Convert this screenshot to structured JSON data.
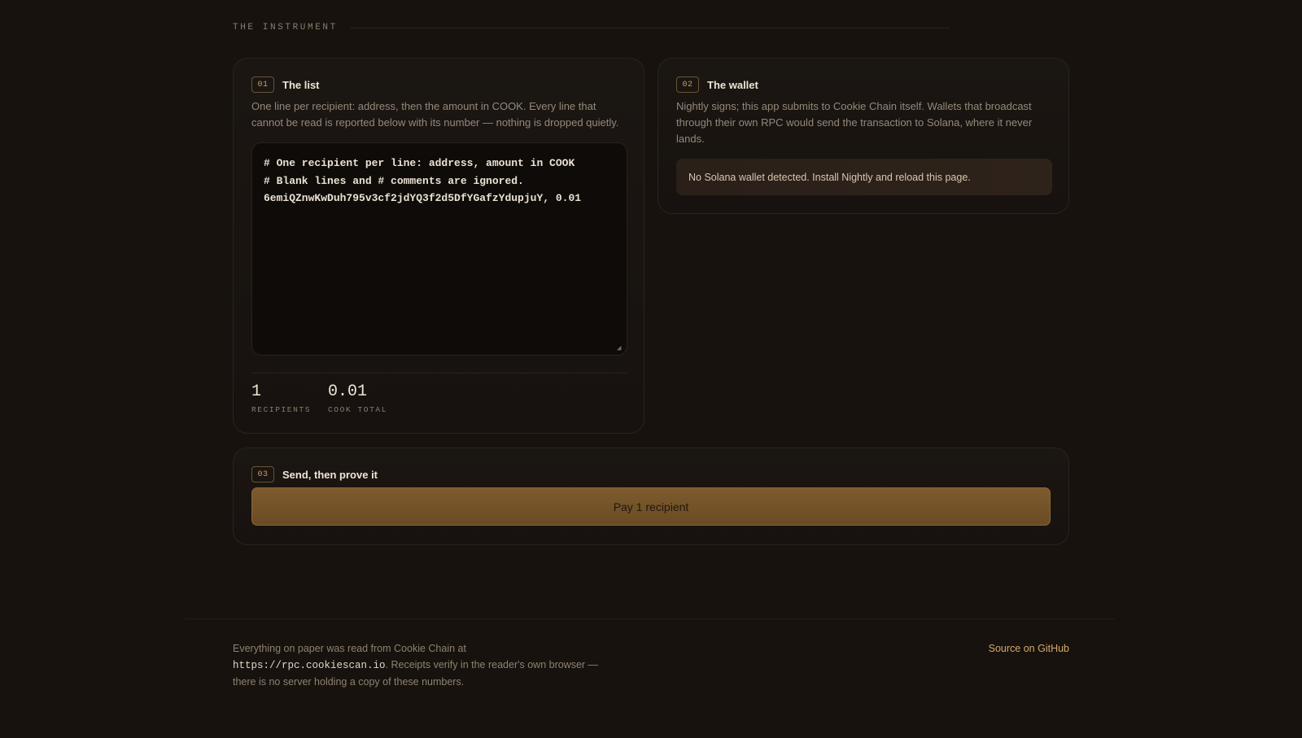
{
  "section": {
    "label": "THE INSTRUMENT"
  },
  "list_card": {
    "step": "01",
    "title": "The list",
    "description": "One line per recipient: address, then the amount in COOK. Every line that cannot be read is reported below with its number — nothing is dropped quietly.",
    "textarea_value": "# One recipient per line: address, amount in COOK\n# Blank lines and # comments are ignored.\n6emiQZnwKwDuh795v3cf2jdYQ3f2d5DfYGafzYdupjuY, 0.01",
    "stats": {
      "recipients_value": "1",
      "recipients_label": "RECIPIENTS",
      "total_value": "0.01",
      "total_label": "COOK TOTAL"
    }
  },
  "wallet_card": {
    "step": "02",
    "title": "The wallet",
    "description": "Nightly signs; this app submits to Cookie Chain itself. Wallets that broadcast through their own RPC would send the transaction to Solana, where it never lands.",
    "notice": "No Solana wallet detected. Install Nightly and reload this page."
  },
  "send_card": {
    "step": "03",
    "title": "Send, then prove it",
    "button_label": "Pay 1 recipient"
  },
  "footer": {
    "text_before": "Everything on paper was read from Cookie Chain at ",
    "rpc_url": "https://rpc.cookiescan.io",
    "text_after": ". Receipts verify in the reader's own browser — there is no server holding a copy of these numbers.",
    "source_link": "Source on GitHub"
  }
}
